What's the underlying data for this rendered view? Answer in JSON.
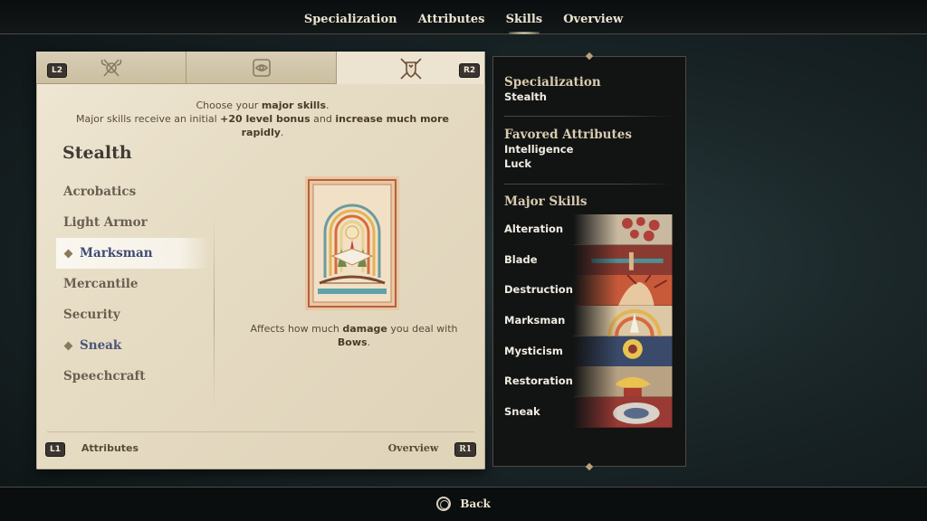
{
  "topnav": {
    "items": [
      "Specialization",
      "Attributes",
      "Skills",
      "Overview"
    ],
    "active_index": 2
  },
  "tabs": {
    "left_button": "L2",
    "right_button": "R2",
    "icons": [
      "crossed-axes-icon",
      "eye-tablet-icon",
      "shield-swords-icon"
    ],
    "active_index": 2
  },
  "intro": {
    "line1_pre": "Choose your ",
    "line1_bold": "major skills",
    "line1_post": ".",
    "line2_pre": "Major skills receive an initial ",
    "line2_bold1": "+20 level bonus",
    "line2_mid": "  and ",
    "line2_bold2": "increase much more rapidly",
    "line2_post": "."
  },
  "group_title": "Stealth",
  "skills": [
    {
      "label": "Acrobatics",
      "selected": false,
      "highlighted": false
    },
    {
      "label": "Light Armor",
      "selected": false,
      "highlighted": false
    },
    {
      "label": "Marksman",
      "selected": true,
      "highlighted": true
    },
    {
      "label": "Mercantile",
      "selected": false,
      "highlighted": false
    },
    {
      "label": "Security",
      "selected": false,
      "highlighted": false
    },
    {
      "label": "Sneak",
      "selected": true,
      "highlighted": false
    },
    {
      "label": "Speechcraft",
      "selected": false,
      "highlighted": false
    }
  ],
  "description": {
    "pre": "Affects how much ",
    "bold1": "damage",
    "mid": " you deal with ",
    "bold2": "Bows",
    "post": "."
  },
  "footer": {
    "left_button": "L1",
    "left_label": "Attributes",
    "right_label": "Overview",
    "right_button": "R1"
  },
  "summary": {
    "specialization_heading": "Specialization",
    "specialization_value": "Stealth",
    "favored_heading": "Favored Attributes",
    "favored_values": [
      "Intelligence",
      "Luck"
    ],
    "major_heading": "Major Skills",
    "major_skills": [
      "Alteration",
      "Blade",
      "Destruction",
      "Marksman",
      "Mysticism",
      "Restoration",
      "Sneak"
    ]
  },
  "bottombar": {
    "back_label": "Back"
  },
  "colors": {
    "parchment": "#ece4d0",
    "selected_text": "#404c74",
    "panel_dark": "#121313",
    "accent_gold": "#b6a27a"
  }
}
